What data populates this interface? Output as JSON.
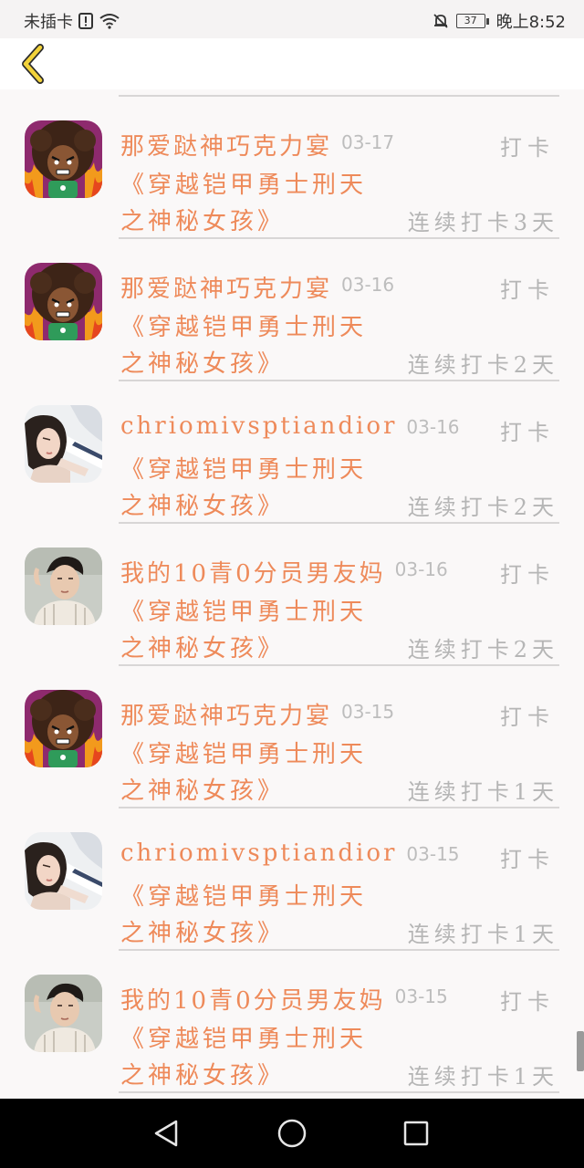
{
  "status_bar": {
    "carrier": "未插卡",
    "battery": "37",
    "time": "晚上8:52"
  },
  "list": {
    "items": [
      {
        "name": "那爱跶神巧克力宴",
        "date": "03-17",
        "punch": "打卡",
        "book_line1": "《穿越铠甲勇士刑天",
        "book_line2": "之神秘女孩》",
        "streak": "连续打卡3天",
        "avatar": "cartoon-afro-avatar"
      },
      {
        "name": "那爱跶神巧克力宴",
        "date": "03-16",
        "punch": "打卡",
        "book_line1": "《穿越铠甲勇士刑天",
        "book_line2": "之神秘女孩》",
        "streak": "连续打卡2天",
        "avatar": "cartoon-afro-avatar"
      },
      {
        "name": "chriomivsptiandior",
        "date": "03-16",
        "punch": "打卡",
        "book_line1": "《穿越铠甲勇士刑天",
        "book_line2": "之神秘女孩》",
        "streak": "连续打卡2天",
        "avatar": "woman-photo-avatar"
      },
      {
        "name": "我的10青0分员男友妈",
        "date": "03-16",
        "punch": "打卡",
        "book_line1": "《穿越铠甲勇士刑天",
        "book_line2": "之神秘女孩》",
        "streak": "连续打卡2天",
        "avatar": "man-photo-avatar"
      },
      {
        "name": "那爱跶神巧克力宴",
        "date": "03-15",
        "punch": "打卡",
        "book_line1": "《穿越铠甲勇士刑天",
        "book_line2": "之神秘女孩》",
        "streak": "连续打卡1天",
        "avatar": "cartoon-afro-avatar"
      },
      {
        "name": "chriomivsptiandior",
        "date": "03-15",
        "punch": "打卡",
        "book_line1": "《穿越铠甲勇士刑天",
        "book_line2": "之神秘女孩》",
        "streak": "连续打卡1天",
        "avatar": "woman-photo-avatar"
      },
      {
        "name": "我的10青0分员男友妈",
        "date": "03-15",
        "punch": "打卡",
        "book_line1": "《穿越铠甲勇士刑天",
        "book_line2": "之神秘女孩》",
        "streak": "连续打卡1天",
        "avatar": "man-photo-avatar"
      }
    ]
  },
  "colors": {
    "accent": "#ee8a5a",
    "muted": "#b5b5b5",
    "back_arrow": "#f2d23a"
  }
}
